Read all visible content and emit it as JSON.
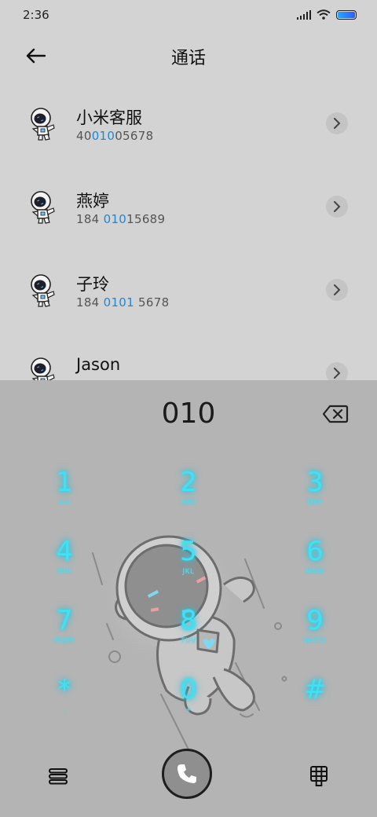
{
  "status": {
    "time": "2:36"
  },
  "header": {
    "title": "通话"
  },
  "contacts": [
    {
      "name": "小米客服",
      "num_pre": "40",
      "num_hl": "010",
      "num_post": "05678"
    },
    {
      "name": "燕婷",
      "num_pre": "184 ",
      "num_hl": "010",
      "num_post": "15689"
    },
    {
      "name": "子玲",
      "num_pre": "184 ",
      "num_hl": "0101",
      "num_post": " 5678"
    },
    {
      "name": "Jason",
      "num_pre": "",
      "num_hl": "",
      "num_post": ""
    }
  ],
  "dialer": {
    "display": "010",
    "keys": [
      {
        "digit": "1",
        "letters": "∞∞"
      },
      {
        "digit": "2",
        "letters": "ABC"
      },
      {
        "digit": "3",
        "letters": "DEF"
      },
      {
        "digit": "4",
        "letters": "GHI"
      },
      {
        "digit": "5",
        "letters": "JKL"
      },
      {
        "digit": "6",
        "letters": "MNO"
      },
      {
        "digit": "7",
        "letters": "PQRS"
      },
      {
        "digit": "8",
        "letters": "TUV"
      },
      {
        "digit": "9",
        "letters": "WXYZ"
      },
      {
        "digit": "*",
        "letters": ","
      },
      {
        "digit": "0",
        "letters": "+"
      },
      {
        "digit": "#",
        "letters": ""
      }
    ]
  },
  "colors": {
    "accent": "#1e88d8",
    "glow": "#3fe2f4",
    "panel": "#b4b4b4",
    "background": "#d3d3d3"
  },
  "icons": {
    "status": [
      "signal-icon",
      "wifi-icon",
      "battery-icon"
    ],
    "header": "back-arrow-icon",
    "row": [
      "astronaut-avatar-icon",
      "chevron-right-icon"
    ],
    "dialer": [
      "backspace-icon",
      "menu-icon",
      "phone-icon",
      "dialpad-icon"
    ]
  }
}
